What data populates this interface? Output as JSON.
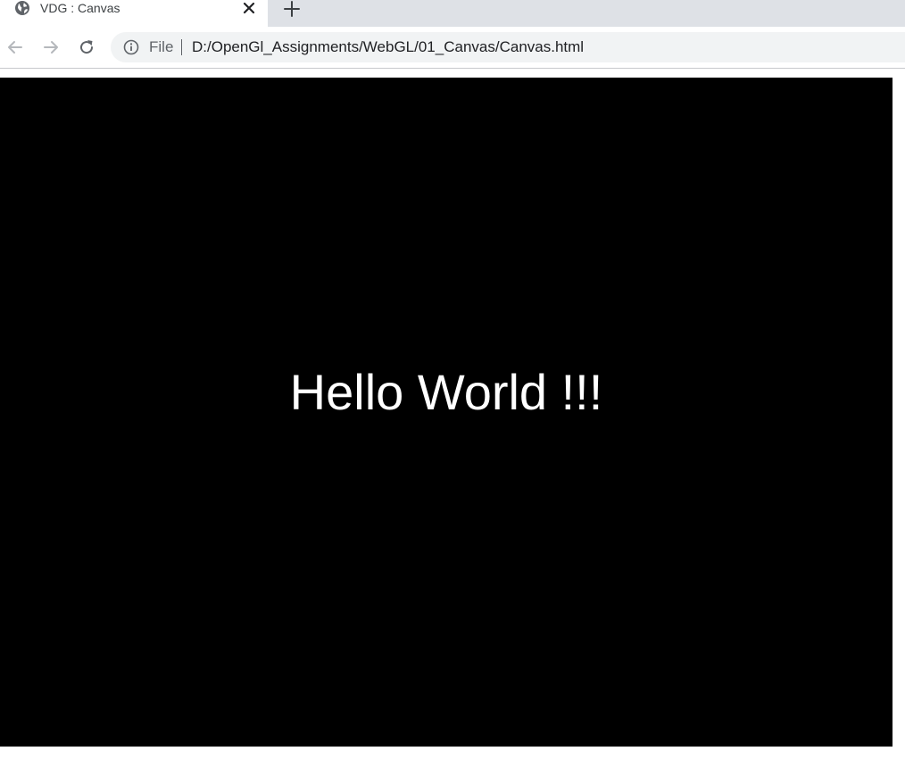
{
  "tab": {
    "title": "VDG : Canvas",
    "favicon": "globe-icon",
    "close_icon": "close-icon"
  },
  "new_tab_icon": "plus-icon",
  "toolbar": {
    "back_icon": "arrow-left-icon",
    "forward_icon": "arrow-right-icon",
    "reload_icon": "reload-icon"
  },
  "omnibox": {
    "info_icon": "info-icon",
    "scheme_label": "File",
    "url": "D:/OpenGl_Assignments/WebGL/01_Canvas/Canvas.html"
  },
  "canvas": {
    "background": "#000000",
    "text": "Hello World !!!",
    "text_color": "#ffffff"
  },
  "colors": {
    "tabstrip": "#dee1e6",
    "omnibox": "#f1f3f4"
  }
}
